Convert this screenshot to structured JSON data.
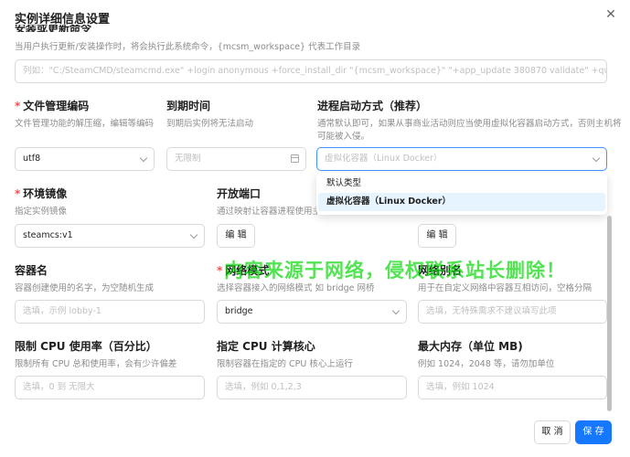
{
  "dialog": {
    "title": "实例详细信息设置",
    "close_icon": "close-icon"
  },
  "install": {
    "label_partial": "安装或更新命令",
    "desc": "当用户执行更新/安装操作时，将会执行此系统命令，{mcsm_workspace} 代表工作目录",
    "placeholder": "列如：\"C:/SteamCMD/steamcmd.exe\" +login anonymous +force_install_dir \"{mcsm_workspace}\" \"+app_update 380870 validate\" +quit"
  },
  "file_encoding": {
    "required": "*",
    "label": "文件管理编码",
    "desc": "文件管理功能的解压缩，编辑等编码",
    "value": "utf8"
  },
  "expire": {
    "label": "到期时间",
    "desc": "到期后实例将无法启动",
    "placeholder": "无限制"
  },
  "process_type": {
    "label": "进程启动方式（推荐）",
    "desc_line1": "通常默认即可，如果从事商业活动则应当使用虚拟化容器启动方式，否则主机将",
    "desc_line2": "可能被入侵。",
    "placeholder": "虚拟化容器（Linux Docker）",
    "options": [
      "默认类型",
      "虚拟化容器（Linux Docker）"
    ]
  },
  "image": {
    "required": "*",
    "label": "环境镜像",
    "desc": "指定实例镜像",
    "value": "steamcs:v1"
  },
  "ports": {
    "label": "开放端口",
    "desc": "通过映射让容器进程使用主机",
    "button": "编 辑"
  },
  "extra_volumes": {
    "button": "编 辑"
  },
  "container_name": {
    "label": "容器名",
    "desc": "容器创建使用的名字，为空随机生成",
    "placeholder": "选填，示例 lobby-1"
  },
  "network_mode": {
    "required": "*",
    "label": "网络模式",
    "desc": "选择容器接入的网络模式 如 bridge 网桥",
    "value": "bridge"
  },
  "network_alias": {
    "label": "网络别名",
    "desc": "用于在自定义网络中容器互相访问，空格分隔",
    "placeholder": "选填，无特殊需求不建议填写此项"
  },
  "cpu_limit": {
    "label": "限制 CPU 使用率（百分比）",
    "desc": "限制所有 CPU 总和使用率，会有少许偏差",
    "placeholder": "选填，0 到 无限大"
  },
  "cpu_cores": {
    "label": "指定 CPU 计算核心",
    "desc": "限制容器在指定的 CPU 核心上运行",
    "placeholder": "选填，例如 0,1,2,3"
  },
  "memory": {
    "label": "最大内存（单位 MB)",
    "desc": "例如 1024，2048 等，请勿加单位",
    "placeholder": "选填，例如 1024"
  },
  "watermark": "内容来源于网络，侵权联系站长删除！",
  "footer": {
    "cancel": "取 消",
    "save": "保 存"
  },
  "colors": {
    "primary": "#1677ff",
    "required": "#ff4d4f",
    "watermark": "#00d600"
  }
}
